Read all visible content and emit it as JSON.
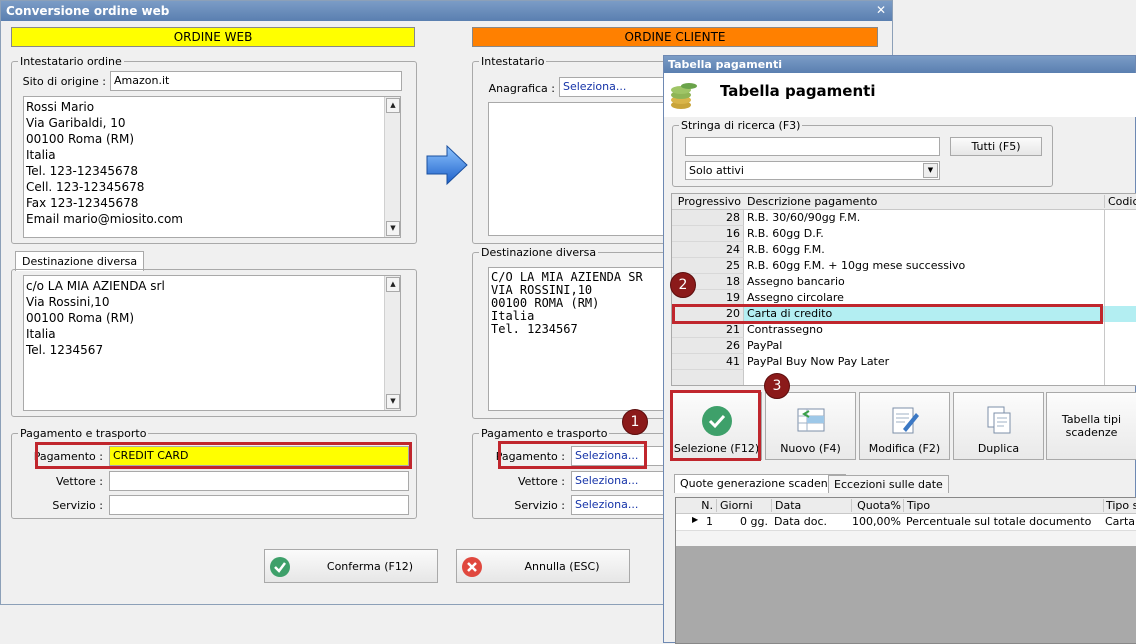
{
  "main_window": {
    "title": "Conversione ordine web",
    "close_glyph": "✕",
    "banner_web": "ORDINE WEB",
    "banner_cliente": "ORDINE CLIENTE",
    "intestatario": {
      "group_title": "Intestatario ordine",
      "sito_label": "Sito di origine :",
      "sito_value": "Amazon.it",
      "address_lines": [
        "Rossi Mario",
        "Via Garibaldi, 10",
        "00100 Roma (RM)",
        "Italia",
        "Tel. 123-12345678",
        "Cell. 123-12345678",
        "Fax 123-12345678",
        "Email mario@miosito.com"
      ]
    },
    "destinazione": {
      "tab_label": "Destinazione diversa",
      "address_lines": [
        "c/o LA MIA AZIENDA srl",
        "Via Rossini,10",
        "00100 Roma (RM)",
        "Italia",
        "Tel. 1234567"
      ]
    },
    "pagamento_trasporto": {
      "group_title": "Pagamento e trasporto",
      "pagamento_label": "Pagamento :",
      "pagamento_value": "CREDIT CARD",
      "vettore_label": "Vettore :",
      "vettore_value": "",
      "servizio_label": "Servizio :",
      "servizio_value": ""
    },
    "cliente_intestatario": {
      "group_title": "Intestatario",
      "anagrafica_label": "Anagrafica :",
      "anagrafica_value": "Seleziona..."
    },
    "cliente_destinazione": {
      "group_title": "Destinazione diversa",
      "address_lines": [
        "C/O LA MIA AZIENDA SR",
        "VIA ROSSINI,10",
        "00100 ROMA (RM)",
        "Italia",
        "Tel. 1234567"
      ]
    },
    "cliente_pagamento": {
      "group_title": "Pagamento e trasporto",
      "pagamento_label": "Pagamento :",
      "pagamento_value": "Seleziona...",
      "vettore_label": "Vettore :",
      "vettore_value": "Seleziona...",
      "servizio_label": "Servizio :",
      "servizio_value": "Seleziona..."
    },
    "confirm_label": "Conferma (F12)",
    "cancel_label": "Annulla (ESC)"
  },
  "dialog": {
    "window_title": "Tabella pagamenti",
    "header_title": "Tabella pagamenti",
    "search": {
      "group_title": "Stringa di ricerca (F3)",
      "value": "",
      "tutti_label": "Tutti (F5)",
      "filter_value": "Solo attivi"
    },
    "grid": {
      "columns": [
        "Progressivo",
        "Descrizione pagamento",
        "Codice"
      ],
      "rows": [
        {
          "prog": "28",
          "desc": "R.B. 30/60/90gg F.M."
        },
        {
          "prog": "16",
          "desc": "R.B. 60gg D.F."
        },
        {
          "prog": "24",
          "desc": "R.B. 60gg F.M."
        },
        {
          "prog": "25",
          "desc": "R.B. 60gg F.M. + 10gg mese successivo"
        },
        {
          "prog": "18",
          "desc": "Assegno bancario"
        },
        {
          "prog": "19",
          "desc": "Assegno circolare"
        },
        {
          "prog": "20",
          "desc": "Carta di credito"
        },
        {
          "prog": "21",
          "desc": "Contrassegno"
        },
        {
          "prog": "26",
          "desc": "PayPal"
        },
        {
          "prog": "41",
          "desc": "PayPal Buy Now Pay Later"
        }
      ],
      "selected_index": 6
    },
    "toolbar": {
      "seleziona": "Selezione (F12)",
      "nuovo": "Nuovo (F4)",
      "modifica": "Modifica (F2)",
      "duplica": "Duplica",
      "tabella_tipi": "Tabella tipi scadenze"
    },
    "tabs": {
      "quote": "Quote generazione scadenze",
      "eccezioni": "Eccezioni sulle date"
    },
    "sched_grid": {
      "columns": [
        "N.",
        "Giorni",
        "Data",
        "Quota%",
        "Tipo",
        "Tipo so"
      ],
      "row": {
        "n": "1",
        "giorni": "0 gg.",
        "data": "Data doc.",
        "quota": "100,00%",
        "tipo": "Percentuale sul totale documento",
        "tipo_so": "Carta"
      }
    }
  },
  "callouts": [
    "1",
    "2",
    "3"
  ],
  "colors": {
    "banner_web": "#ffff00",
    "banner_cliente": "#ff8000",
    "highlight_field": "#ffff00",
    "selected_row": "#b3eef2",
    "callout_border": "#c0262d",
    "badge": "#8b1a1a",
    "link_text": "#1533a8"
  }
}
